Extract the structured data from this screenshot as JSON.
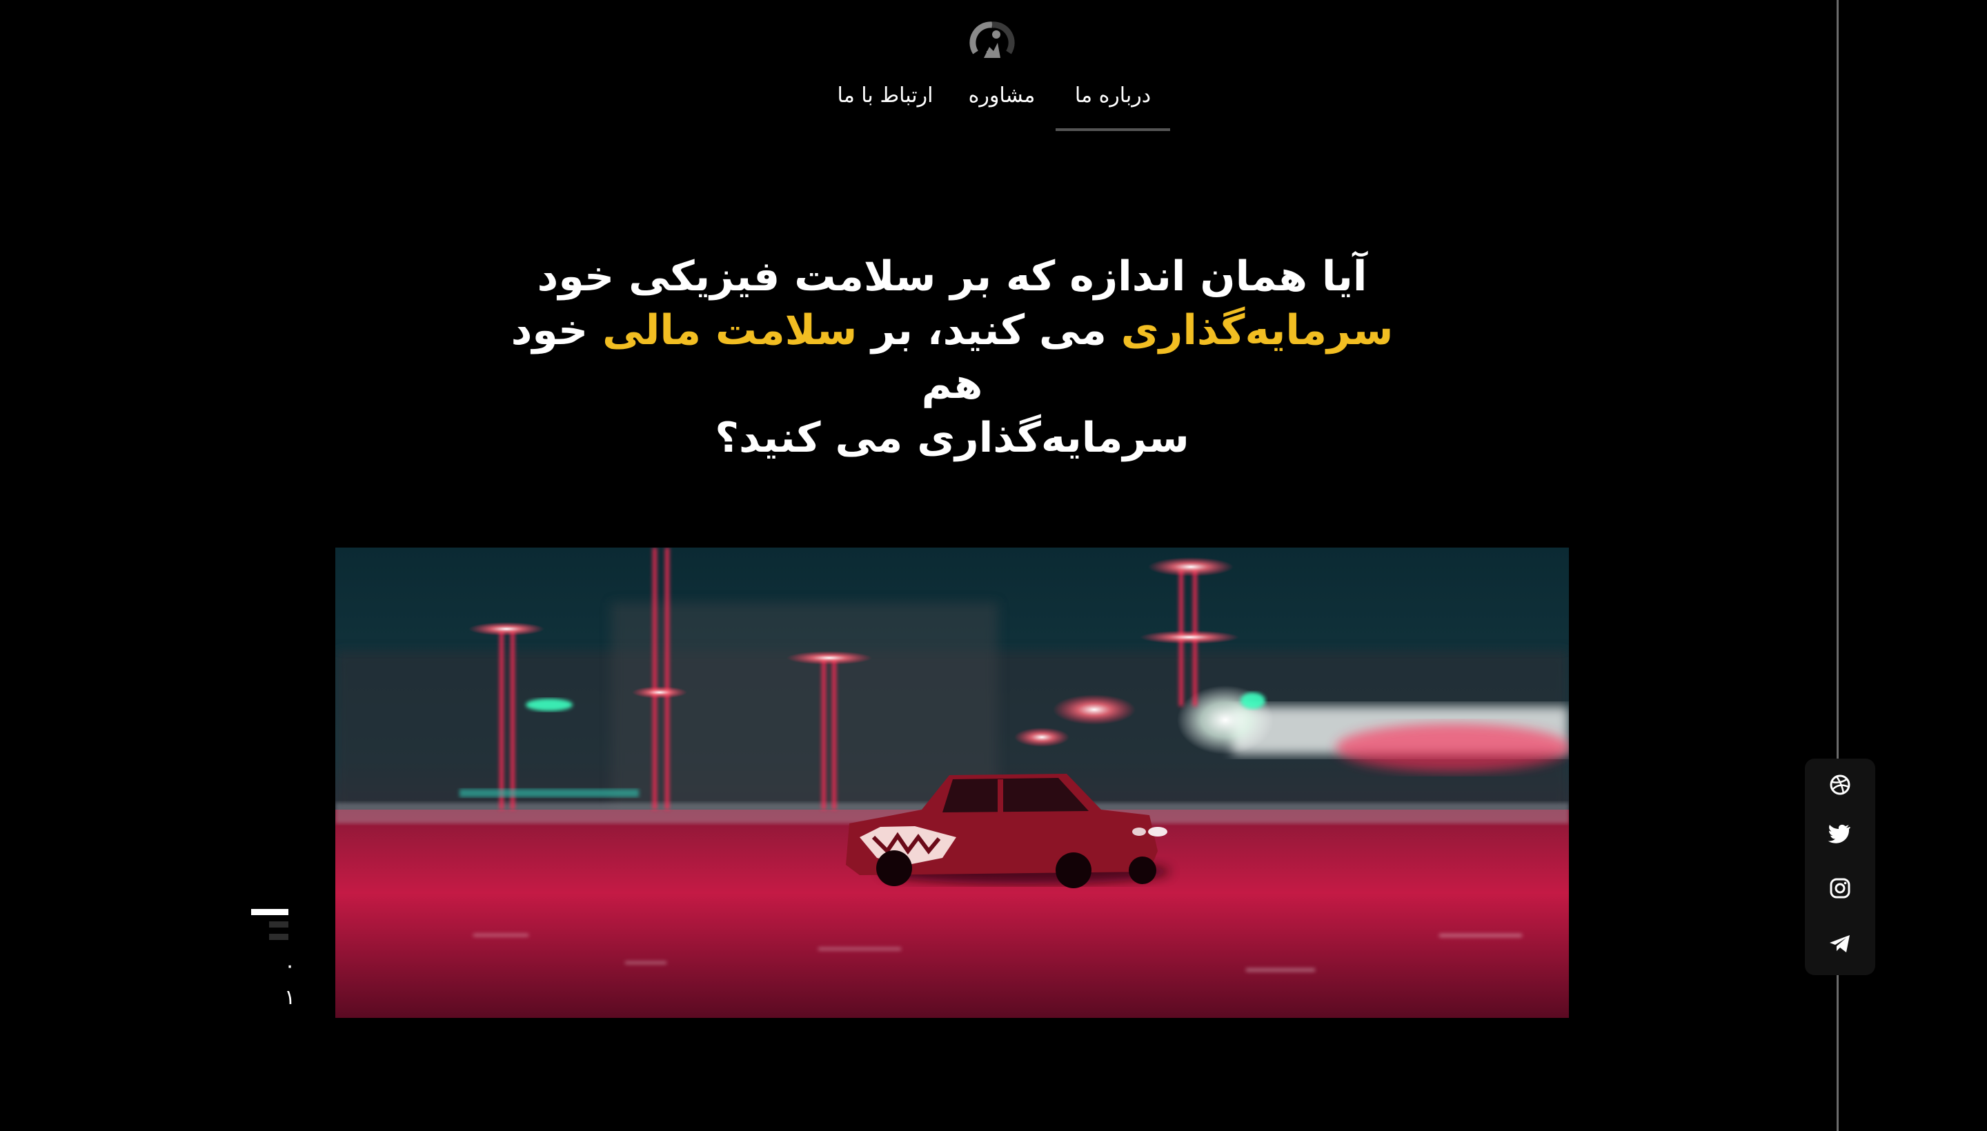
{
  "header": {
    "logo_icon": "gauge-person-logo-icon"
  },
  "nav": {
    "items": [
      {
        "label": "درباره ما",
        "active": true
      },
      {
        "label": "مشاوره",
        "active": false
      },
      {
        "label": "ارتباط با ما",
        "active": false
      }
    ]
  },
  "hero": {
    "headline": {
      "line1": "آیا همان اندازه که بر سلامت فیزیکی خود",
      "line2_part1": "سرمایه‌گذاری",
      "line2_part2": " می کنید، بر ",
      "line2_part3": "سلامت مالی",
      "line2_part4": " خود هم",
      "line3": "سرمایه‌گذاری می کنید؟"
    },
    "image_subject": "red car drifting at night with neon lights"
  },
  "slider": {
    "total": "۰",
    "current": "۱"
  },
  "social": {
    "items": [
      {
        "icon": "dribbble-icon"
      },
      {
        "icon": "twitter-icon"
      },
      {
        "icon": "instagram-icon"
      },
      {
        "icon": "telegram-icon"
      }
    ]
  },
  "colors": {
    "background": "#000000",
    "highlight": "#f2be22",
    "text": "#ffffff",
    "nav_underline": "#555555"
  }
}
